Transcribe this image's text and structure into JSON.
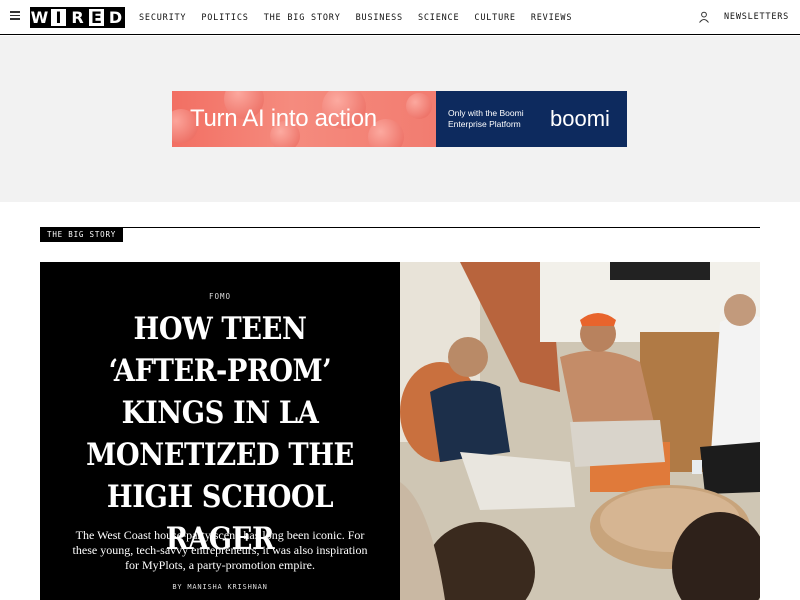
{
  "header": {
    "logo_letters": [
      "W",
      "I",
      "R",
      "E",
      "D"
    ],
    "nav": [
      "SECURITY",
      "POLITICS",
      "THE BIG STORY",
      "BUSINESS",
      "SCIENCE",
      "CULTURE",
      "REVIEWS"
    ],
    "newsletters": "NEWSLETTERS"
  },
  "ad": {
    "headline": "Turn AI into action",
    "subline": "Only with the Boomi Enterprise Platform",
    "brand": "boomi",
    "colors": {
      "left": "#f26f63",
      "right": "#0d2a5e"
    }
  },
  "section": {
    "label": "THE BIG STORY"
  },
  "feature": {
    "rubric": "FOMO",
    "headline": "HOW TEEN ‘AFTER-PROM’ KINGS IN LA MONETIZED THE HIGH SCHOOL RAGER",
    "dek": "The West Coast house-party scene has long been iconic. For these young, tech-savvy entrepreneurs, it was also inspiration for MyPlots, a party-promotion empire.",
    "byline": "BY MANISHA KRISHNAN"
  },
  "colors": {
    "accent": "#000000",
    "ad_band": "#f2f2f2"
  }
}
